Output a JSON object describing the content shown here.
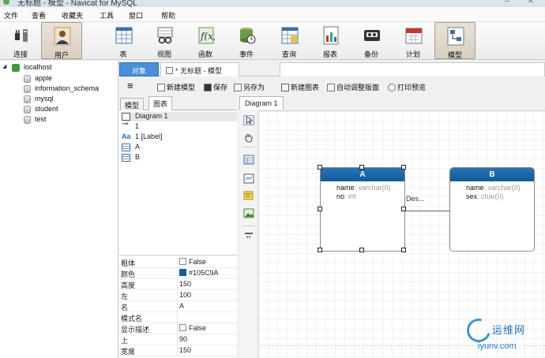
{
  "window": {
    "title": "无标题 - 模型 - Navicat for MySQL"
  },
  "menu": [
    "文件",
    "查看",
    "收藏夹",
    "工具",
    "窗口",
    "帮助"
  ],
  "toolbar": {
    "connect": "连接",
    "user": "用户",
    "table": "表",
    "view": "视图",
    "function": "函数",
    "event": "事件",
    "query": "查询",
    "report": "报表",
    "backup": "备份",
    "schedule": "计划",
    "model": "模型"
  },
  "tree": {
    "connection": "localhost",
    "databases": [
      "apple",
      "information_schema",
      "mysql",
      "student",
      "test"
    ]
  },
  "tabs": {
    "objects": "对象",
    "model_tab": "* 无标题 - 模型"
  },
  "model_toolbar": {
    "menu_icon": "≡",
    "new_model": "新建模型",
    "save": "保存",
    "save_as": "另存为",
    "new_diagram": "新建图表",
    "auto_layout": "自动调整版面",
    "print_preview": "打印预览"
  },
  "inner_tabs": {
    "model": "模型",
    "diagram": "图表"
  },
  "outline": {
    "diagram": "Diagram 1",
    "relation": "1",
    "label": "1 [Label]",
    "tables": [
      "A",
      "B"
    ]
  },
  "properties": [
    {
      "key": "粗体",
      "value": "False",
      "type": "checkbox"
    },
    {
      "key": "颜色",
      "value": "#105C9A",
      "type": "color"
    },
    {
      "key": "高度",
      "value": "150"
    },
    {
      "key": "左",
      "value": "100"
    },
    {
      "key": "名",
      "value": "A"
    },
    {
      "key": "模式名",
      "value": ""
    },
    {
      "key": "显示描述",
      "value": "False",
      "type": "checkbox"
    },
    {
      "key": "上",
      "value": "90"
    },
    {
      "key": "宽度",
      "value": "150"
    }
  ],
  "diagram_tab": "Diagram 1",
  "entities": {
    "a": {
      "name": "A",
      "fields": [
        {
          "name": "name",
          "type": ": varchar(0)"
        },
        {
          "name": "no",
          "type": ": int"
        }
      ]
    },
    "b": {
      "name": "B",
      "fields": [
        {
          "name": "name",
          "type": ": varchar(0)"
        },
        {
          "name": "sex",
          "type": ": char(0)"
        }
      ]
    }
  },
  "relation_label": "Des...",
  "watermark": {
    "text": "运维网",
    "url": "iyunv.com"
  },
  "colors": {
    "entity_header": "#105C9A",
    "objects_tab": "#4a90d9",
    "accent": "#105C9A"
  }
}
